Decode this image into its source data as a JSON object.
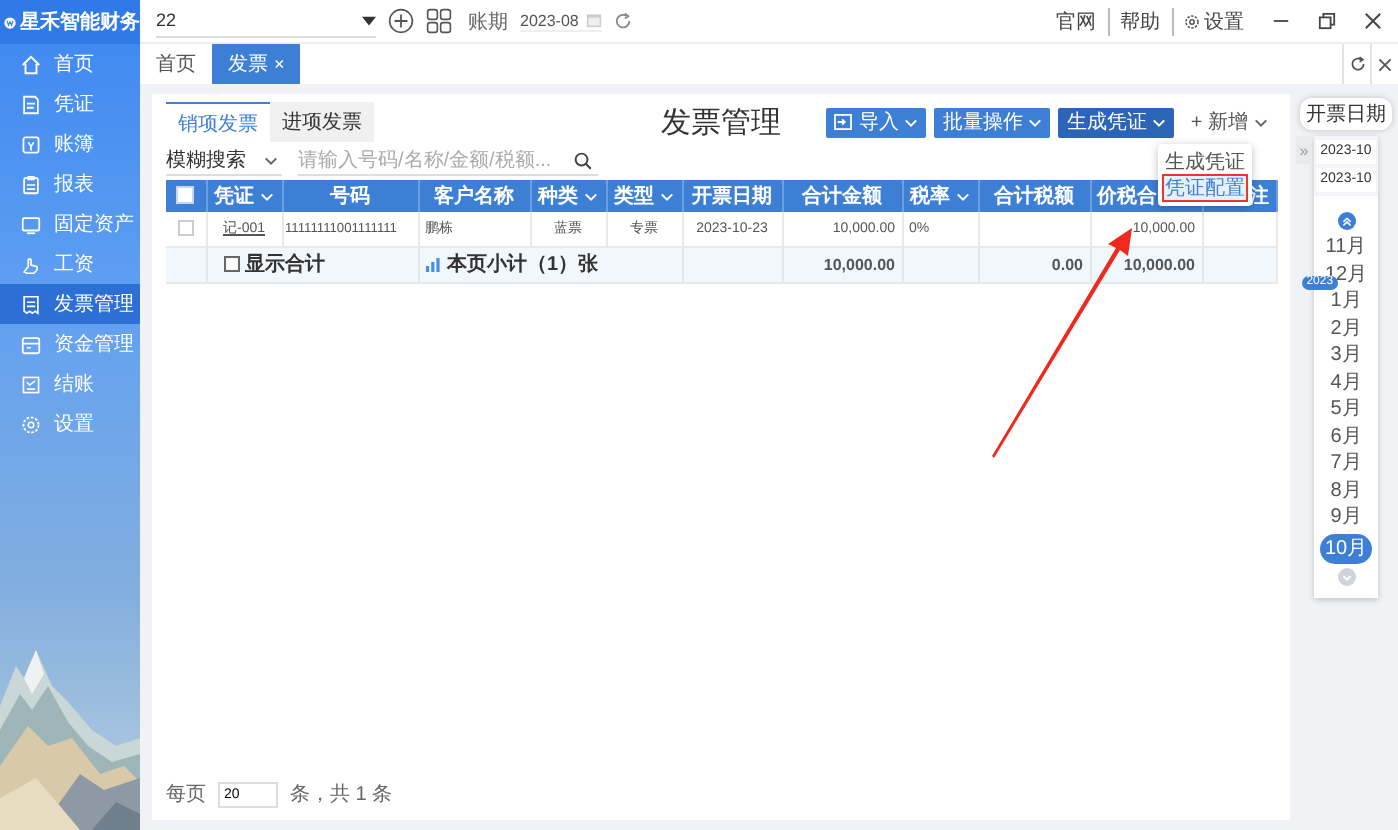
{
  "app": {
    "logo": "星禾智能财务"
  },
  "sidebar": {
    "items": [
      {
        "label": "首页",
        "selected": false
      },
      {
        "label": "凭证",
        "selected": false
      },
      {
        "label": "账簿",
        "selected": false
      },
      {
        "label": "报表",
        "selected": false
      },
      {
        "label": "固定资产",
        "selected": false
      },
      {
        "label": "工资",
        "selected": false
      },
      {
        "label": "发票管理",
        "selected": true
      },
      {
        "label": "资金管理",
        "selected": false
      },
      {
        "label": "结账",
        "selected": false
      },
      {
        "label": "设置",
        "selected": false
      }
    ]
  },
  "topbar": {
    "account": "22",
    "period_label": "账期",
    "period": "2023-08",
    "links": [
      "官网",
      "帮助",
      "设置"
    ]
  },
  "tabs": [
    {
      "label": "首页",
      "selected": false
    },
    {
      "label": "发票",
      "selected": true,
      "close": "×"
    }
  ],
  "invoice_tabs": [
    {
      "label": "销项发票",
      "selected": true
    },
    {
      "label": "进项发票",
      "selected": false
    }
  ],
  "title": "发票管理",
  "toolbar": [
    {
      "label": "导入",
      "kind": "primary",
      "selected": false
    },
    {
      "label": "批量操作",
      "kind": "primary",
      "selected": false
    },
    {
      "label": "生成凭证",
      "kind": "primary",
      "selected": true
    },
    {
      "label": "+ 新增",
      "kind": "plain",
      "selected": false
    }
  ],
  "menu": {
    "items": [
      {
        "label": "生成凭证",
        "highlighted": false
      },
      {
        "label": "凭证配置",
        "highlighted": true
      }
    ]
  },
  "search": {
    "mode": "模糊搜索",
    "placeholder": "请输入号码/名称/金额/税额..."
  },
  "table": {
    "header_checked": false,
    "columns": [
      {
        "label": "凭证",
        "sortable": true
      },
      {
        "label": "号码",
        "sortable": false
      },
      {
        "label": "客户名称",
        "sortable": false
      },
      {
        "label": "种类",
        "sortable": true
      },
      {
        "label": "类型",
        "sortable": true
      },
      {
        "label": "开票日期",
        "sortable": false
      },
      {
        "label": "合计金额",
        "sortable": false
      },
      {
        "label": "税率",
        "sortable": true
      },
      {
        "label": "合计税额",
        "sortable": false
      },
      {
        "label": "价税合",
        "sortable": false
      },
      {
        "label": "注",
        "sortable": false
      }
    ],
    "rows": [
      {
        "checked": false,
        "cells": [
          "记-001",
          "11111111001111111",
          "鹏栋",
          "蓝票",
          "专票",
          "2023-10-23",
          "10,000.00",
          "0%",
          "",
          "10,000.00",
          ""
        ]
      }
    ],
    "summary": {
      "show_total": false,
      "show_total_label": "显示合计",
      "subtotal": "本页小计（1）张",
      "amount": "10,000.00",
      "tax": "0.00",
      "total": "10,000.00"
    }
  },
  "pagination": {
    "per_page_label": "每页",
    "per_page": "20",
    "total": "条，共 1 条"
  },
  "date_panel": {
    "tooltip": "开票日期",
    "collapse": "»",
    "from": "2023-10",
    "to": "2023-10",
    "months": [
      {
        "label": "11月",
        "selected": false
      },
      {
        "label": "12月",
        "selected": false
      },
      {
        "label": "1月",
        "selected": false,
        "year": "2023"
      },
      {
        "label": "2月",
        "selected": false
      },
      {
        "label": "3月",
        "selected": false
      },
      {
        "label": "4月",
        "selected": false
      },
      {
        "label": "5月",
        "selected": false
      },
      {
        "label": "6月",
        "selected": false
      },
      {
        "label": "7月",
        "selected": false
      },
      {
        "label": "8月",
        "selected": false
      },
      {
        "label": "9月",
        "selected": false
      },
      {
        "label": "10月",
        "selected": true
      }
    ]
  }
}
